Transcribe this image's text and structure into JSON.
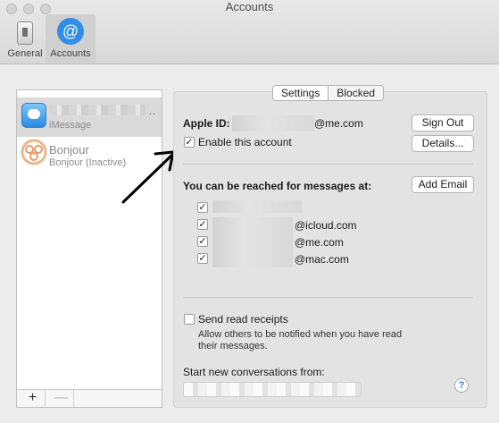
{
  "window": {
    "title": "Accounts"
  },
  "toolbar": {
    "general_label": "General",
    "accounts_label": "Accounts"
  },
  "accounts": [
    {
      "name": "",
      "subtitle": "iMessage",
      "icon": "imessage-icon",
      "selected": true
    },
    {
      "name": "Bonjour",
      "subtitle": "Bonjour (Inactive)",
      "icon": "bonjour-icon",
      "selected": false
    }
  ],
  "list_footer": {
    "add_label": "+",
    "remove_label": "—"
  },
  "tabs": {
    "settings": "Settings",
    "blocked": "Blocked"
  },
  "settings": {
    "apple_id_label": "Apple ID:",
    "apple_id_suffix": "@me.com",
    "sign_out": "Sign Out",
    "enable_account": "Enable this account",
    "enable_checked": true,
    "details": "Details...",
    "reached_heading": "You can be reached for messages at:",
    "add_email": "Add Email",
    "addresses": [
      {
        "suffix": "",
        "checked": true
      },
      {
        "suffix": "@icloud.com",
        "checked": true
      },
      {
        "suffix": "@me.com",
        "checked": true
      },
      {
        "suffix": "@mac.com",
        "checked": true
      }
    ],
    "read_receipts_label": "Send read receipts",
    "read_receipts_checked": false,
    "read_receipts_desc_1": "Allow others to be notified when you have read",
    "read_receipts_desc_2": "their messages.",
    "start_conversations_label": "Start new conversations from:",
    "help": "?"
  },
  "colors": {
    "accent": "#2f8ee8",
    "window_bg": "#ececec"
  }
}
